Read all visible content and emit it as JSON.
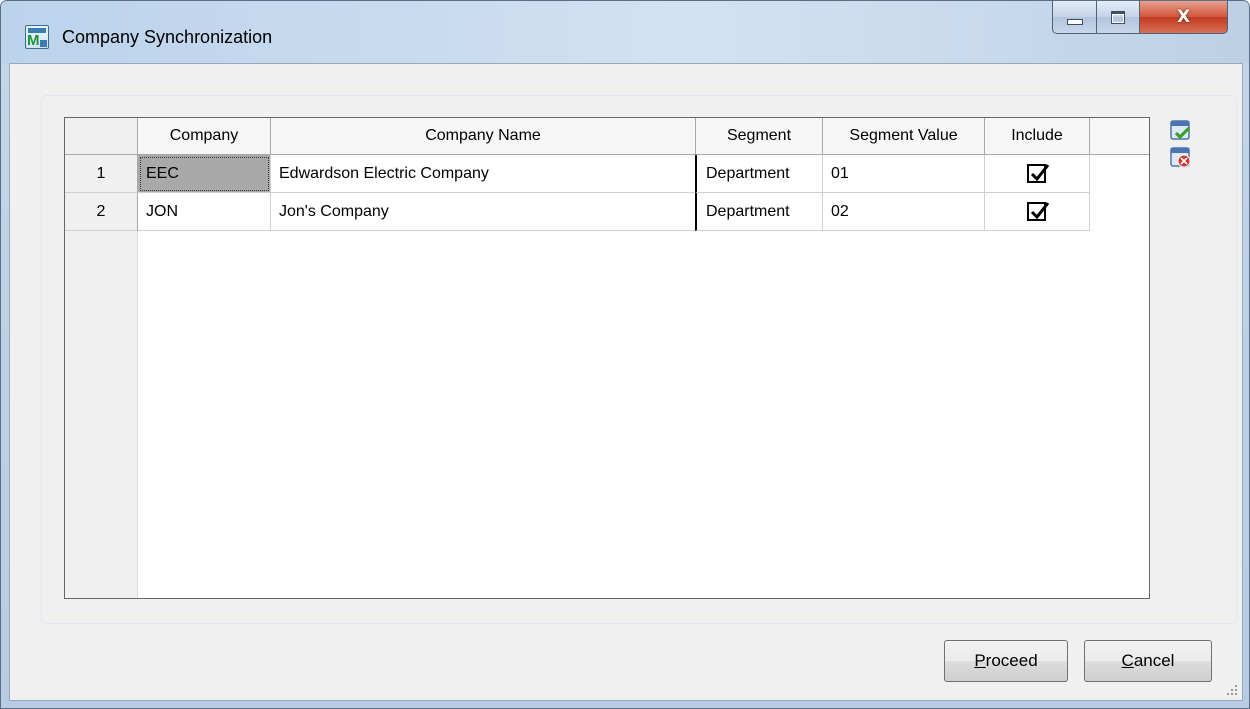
{
  "window": {
    "title": "Company Synchronization",
    "icon": "app-icon",
    "controls": {
      "minimize": "minimize-icon",
      "maximize": "maximize-icon",
      "close": "X"
    }
  },
  "grid": {
    "columns": [
      "Company",
      "Company Name",
      "Segment",
      "Segment Value",
      "Include"
    ],
    "rows": [
      {
        "num": "1",
        "company": "EEC",
        "company_name": "Edwardson Electric Company",
        "segment": "Department",
        "segment_value": "01",
        "include": true
      },
      {
        "num": "2",
        "company": "JON",
        "company_name": "Jon's Company",
        "segment": "Department",
        "segment_value": "02",
        "include": true
      }
    ]
  },
  "side_tools": [
    "select-all-icon",
    "clear-all-icon"
  ],
  "buttons": {
    "proceed": {
      "accel": "P",
      "rest": "roceed"
    },
    "cancel": {
      "accel": "C",
      "rest": "ancel"
    }
  },
  "colors": {
    "selected_cell": "#a9a9a9",
    "check_green": "#3aa02c",
    "clear_red": "#d9352a"
  }
}
